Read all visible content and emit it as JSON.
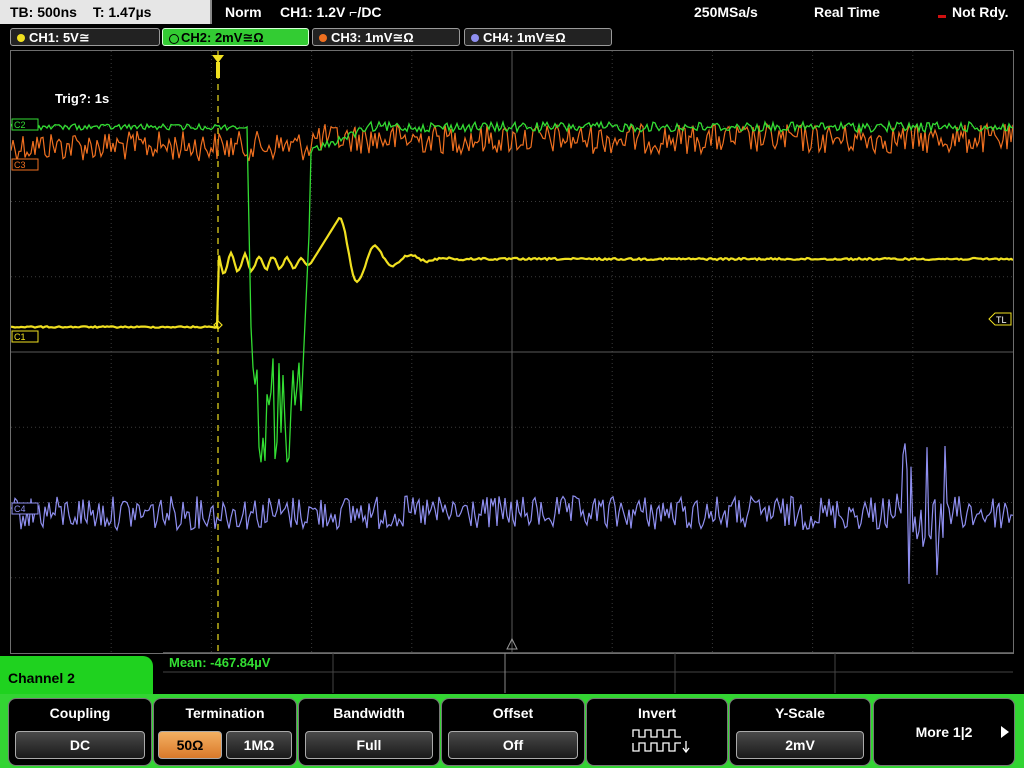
{
  "topbar": {
    "timebase": "TB: 500ns",
    "trigger_time": "T: 1.47µs",
    "trigger_mode": "Norm",
    "trigger_setting": "CH1: 1.2V ⌐/DC",
    "sample_rate": "250MSa/s",
    "acq_mode": "Real Time",
    "status": "Not Rdy."
  },
  "channels": [
    {
      "label": "CH1: 5V≅",
      "color": "#f0e020"
    },
    {
      "label": "CH2: 2mV≅Ω",
      "color": "#33cc33"
    },
    {
      "label": "CH3: 1mV≅Ω",
      "color": "#f07020"
    },
    {
      "label": "CH4: 1mV≅Ω",
      "color": "#8f8ff0"
    }
  ],
  "display": {
    "trig_text": "Trig?: 1s",
    "markers": {
      "c1": "C1",
      "c2": "C2",
      "c3": "C3",
      "c4": "C4",
      "tl": "TL"
    }
  },
  "measurement": {
    "mean": "Mean: -467.84µV"
  },
  "channel_panel": {
    "label": "Channel 2"
  },
  "softkeys": {
    "coupling": {
      "label": "Coupling",
      "value": "DC"
    },
    "termination": {
      "label": "Termination",
      "opt1": "50Ω",
      "opt2": "1MΩ"
    },
    "bandwidth": {
      "label": "Bandwidth",
      "value": "Full"
    },
    "offset": {
      "label": "Offset",
      "value": "Off"
    },
    "invert": {
      "label": "Invert"
    },
    "yscale": {
      "label": "Y-Scale",
      "value": "2mV"
    },
    "more": {
      "label": "More 1|2"
    }
  },
  "colors": {
    "ch1": "#f0e020",
    "ch2": "#33dd33",
    "ch3": "#f07020",
    "ch4": "#8f8ff0"
  }
}
